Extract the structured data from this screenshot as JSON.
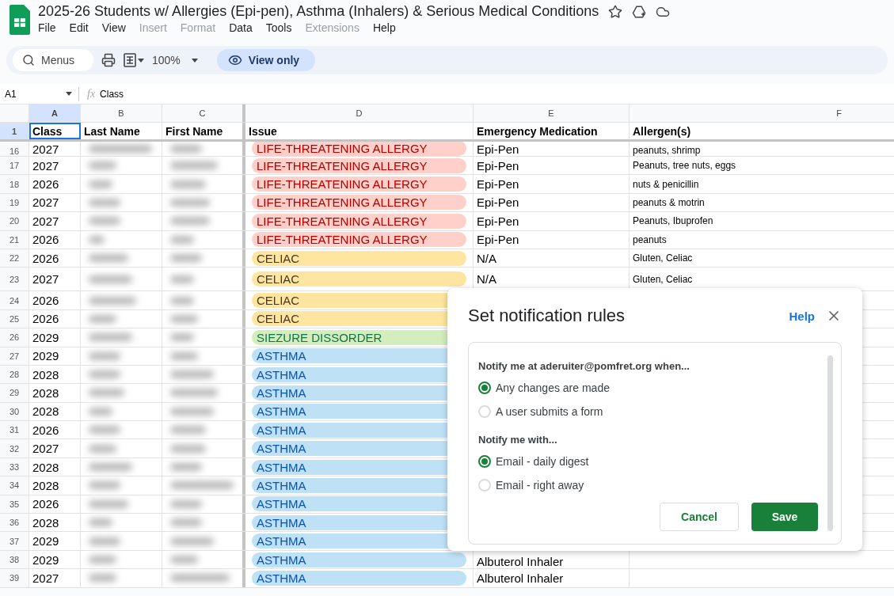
{
  "document": {
    "title": "2025-26 Students w/ Allergies (Epi-pen), Asthma (Inhalers) & Serious Medical Conditions"
  },
  "menu": [
    {
      "label": "File",
      "disabled": false
    },
    {
      "label": "Edit",
      "disabled": false
    },
    {
      "label": "View",
      "disabled": false
    },
    {
      "label": "Insert",
      "disabled": true
    },
    {
      "label": "Format",
      "disabled": true
    },
    {
      "label": "Data",
      "disabled": false
    },
    {
      "label": "Tools",
      "disabled": false
    },
    {
      "label": "Extensions",
      "disabled": true
    },
    {
      "label": "Help",
      "disabled": false
    }
  ],
  "toolbar": {
    "search_placeholder": "Menus",
    "zoom": "100%",
    "view_button": "View only"
  },
  "formula_bar": {
    "cell_ref": "A1",
    "fx": "fx",
    "value": "Class"
  },
  "columns": [
    {
      "letter": "A",
      "selected": true
    },
    {
      "letter": "B",
      "selected": false
    },
    {
      "letter": "C",
      "selected": false
    },
    {
      "letter": "D",
      "selected": false
    },
    {
      "letter": "E",
      "selected": false
    },
    {
      "letter": "F",
      "selected": false
    }
  ],
  "header_row": {
    "number": "1",
    "selected": true,
    "cells": [
      {
        "text": "Class",
        "selected": true
      },
      {
        "text": "Last Name",
        "selected": false
      },
      {
        "text": "First  Name",
        "selected": false
      },
      {
        "text": "Issue",
        "selected": false
      },
      {
        "text": "Emergency Medication",
        "selected": false
      },
      {
        "text": "Allergen(s)",
        "selected": false
      }
    ]
  },
  "rows": [
    {
      "number": "16",
      "class": "2027",
      "issue": {
        "kind": "allergy",
        "text": "LIFE-THREATENING ALLERGY"
      },
      "medication": "Epi-Pen",
      "allergens": "peanuts, shrimp"
    },
    {
      "number": "17",
      "class": "2027",
      "issue": {
        "kind": "allergy",
        "text": "LIFE-THREATENING ALLERGY"
      },
      "medication": "Epi-Pen",
      "allergens": "Peanuts, tree nuts, eggs"
    },
    {
      "number": "18",
      "class": "2026",
      "issue": {
        "kind": "allergy",
        "text": "LIFE-THREATENING ALLERGY"
      },
      "medication": "Epi-Pen",
      "allergens": "nuts & penicillin"
    },
    {
      "number": "19",
      "class": "2027",
      "issue": {
        "kind": "allergy",
        "text": "LIFE-THREATENING ALLERGY"
      },
      "medication": "Epi-Pen",
      "allergens": "peanuts & motrin"
    },
    {
      "number": "20",
      "class": "2027",
      "issue": {
        "kind": "allergy",
        "text": "LIFE-THREATENING ALLERGY"
      },
      "medication": "Epi-Pen",
      "allergens": "Peanuts, Ibuprofen"
    },
    {
      "number": "21",
      "class": "2026",
      "issue": {
        "kind": "allergy",
        "text": "LIFE-THREATENING ALLERGY"
      },
      "medication": "Epi-Pen",
      "allergens": "peanuts"
    },
    {
      "number": "22",
      "class": "2026",
      "issue": {
        "kind": "celiac",
        "text": "CELIAC"
      },
      "medication": "N/A",
      "allergens": "Gluten, Celiac"
    },
    {
      "number": "23",
      "class": "2027",
      "issue": {
        "kind": "celiac",
        "text": "CELIAC"
      },
      "medication": "N/A",
      "allergens": "Gluten, Celiac"
    },
    {
      "number": "24",
      "class": "2026",
      "issue": {
        "kind": "celiac",
        "text": "CELIAC"
      }
    },
    {
      "number": "25",
      "class": "2026",
      "issue": {
        "kind": "celiac",
        "text": "CELIAC"
      }
    },
    {
      "number": "26",
      "class": "2029",
      "issue": {
        "kind": "seizure",
        "text": "SIEZURE DISSORDER"
      }
    },
    {
      "number": "27",
      "class": "2029",
      "issue": {
        "kind": "asthma",
        "text": "ASTHMA"
      }
    },
    {
      "number": "28",
      "class": "2028",
      "issue": {
        "kind": "asthma",
        "text": "ASTHMA"
      }
    },
    {
      "number": "29",
      "class": "2028",
      "issue": {
        "kind": "asthma",
        "text": "ASTHMA"
      }
    },
    {
      "number": "30",
      "class": "2028",
      "issue": {
        "kind": "asthma",
        "text": "ASTHMA"
      }
    },
    {
      "number": "31",
      "class": "2026",
      "issue": {
        "kind": "asthma",
        "text": "ASTHMA"
      }
    },
    {
      "number": "32",
      "class": "2027",
      "issue": {
        "kind": "asthma",
        "text": "ASTHMA"
      }
    },
    {
      "number": "33",
      "class": "2028",
      "issue": {
        "kind": "asthma",
        "text": "ASTHMA"
      }
    },
    {
      "number": "34",
      "class": "2028",
      "issue": {
        "kind": "asthma",
        "text": "ASTHMA"
      }
    },
    {
      "number": "35",
      "class": "2026",
      "issue": {
        "kind": "asthma",
        "text": "ASTHMA"
      }
    },
    {
      "number": "36",
      "class": "2028",
      "issue": {
        "kind": "asthma",
        "text": "ASTHMA"
      }
    },
    {
      "number": "37",
      "class": "2029",
      "issue": {
        "kind": "asthma",
        "text": "ASTHMA"
      }
    },
    {
      "number": "38",
      "class": "2029",
      "issue": {
        "kind": "asthma",
        "text": "ASTHMA"
      },
      "medication": "Albuterol Inhaler"
    },
    {
      "number": "39",
      "class": "2027",
      "issue": {
        "kind": "asthma",
        "text": "ASTHMA"
      },
      "medication": "Albuterol Inhaler"
    }
  ],
  "dialog": {
    "title": "Set notification rules",
    "help": "Help",
    "groups": [
      {
        "heading": "Notify me at aderuiter@pomfret.org when...",
        "options": [
          {
            "label": "Any changes are made",
            "selected": true
          },
          {
            "label": "A user submits a form",
            "selected": false
          }
        ]
      },
      {
        "heading": "Notify me with...",
        "options": [
          {
            "label": "Email - daily digest",
            "selected": true
          },
          {
            "label": "Email - right away",
            "selected": false
          }
        ]
      }
    ],
    "buttons": [
      {
        "label": "Cancel",
        "kind": "secondary"
      },
      {
        "label": "Save",
        "kind": "primary"
      }
    ]
  }
}
